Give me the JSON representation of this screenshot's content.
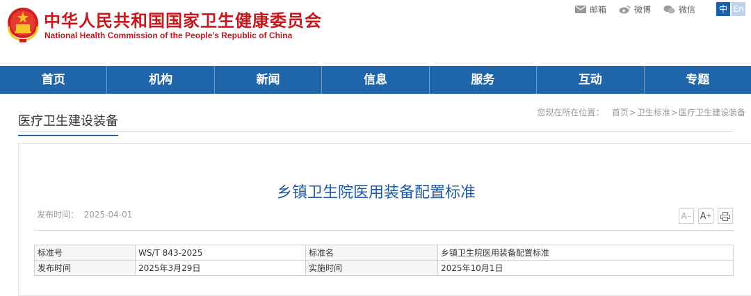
{
  "header": {
    "site_name_cn": "中华人民共和国国家卫生健康委员会",
    "site_name_en": "National Health Commission of the People’s Republic of China",
    "top_links": [
      {
        "label": "邮箱",
        "icon": "mail-icon"
      },
      {
        "label": "微博",
        "icon": "weibo-icon"
      },
      {
        "label": "微信",
        "icon": "wechat-icon"
      }
    ],
    "lang_cn": "中",
    "lang_en": "En"
  },
  "nav": {
    "items": [
      "首页",
      "机构",
      "新闻",
      "信息",
      "服务",
      "互动",
      "专题"
    ]
  },
  "section": {
    "title": "医疗卫生建设装备",
    "breadcrumb_prefix": "您现在所在位置：",
    "breadcrumb": [
      "首页",
      "卫生标准",
      "医疗卫生建设装备"
    ]
  },
  "article": {
    "title": "乡镇卫生院医用装备配置标准",
    "pubdate_label": "发布时间：",
    "pubdate": "2025-04-01",
    "font_decrease_label": "A",
    "font_increase_label": "A",
    "table": [
      [
        "标准号",
        "WS/T 843-2025",
        "标准名",
        "乡镇卫生院医用装备配置标准"
      ],
      [
        "发布时间",
        "2025年3月29日",
        "实施时间",
        "2025年10月1日"
      ]
    ]
  },
  "colors": {
    "brand_red": "#c8161d",
    "nav_blue": "#1f65aa",
    "title_blue": "#1f5aa0"
  }
}
